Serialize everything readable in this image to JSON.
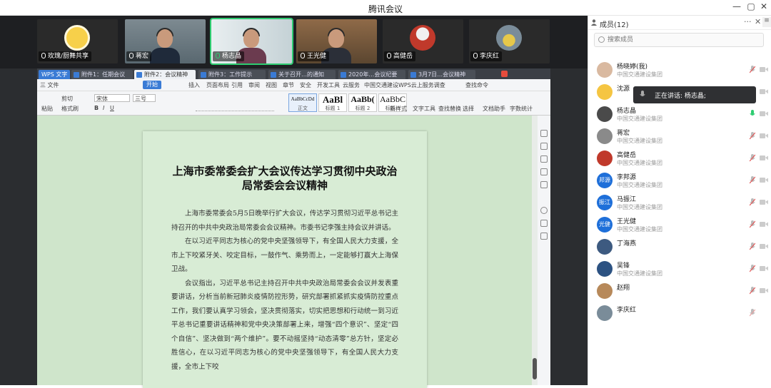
{
  "window": {
    "title": "腾讯会议",
    "controls": [
      "—",
      "▢",
      "✕"
    ]
  },
  "video_tiles": [
    {
      "name": "玫瑰/厨舞共享",
      "muted": true
    },
    {
      "name": "蒋宏",
      "muted": true
    },
    {
      "name": "杨志晶",
      "muted": false,
      "active": true
    },
    {
      "name": "王光健",
      "muted": true
    },
    {
      "name": "高健岳",
      "muted": true
    },
    {
      "name": "李庆红",
      "muted": true
    }
  ],
  "wps": {
    "tabs": [
      "WPS 文字",
      "附件1：任期会议",
      "附件2：会议精神",
      "附件3：工作提示",
      "关于召开…的通知",
      "2020年…会议纪要",
      "3月7日…会议精神"
    ],
    "menu": [
      "三 文件",
      "开始",
      "插入",
      "页面布局",
      "引用",
      "审阅",
      "视图",
      "章节",
      "安全",
      "开发工具",
      "云服务",
      "中国交通建设WPS云上服务调查",
      "查找命令"
    ],
    "toolbar": {
      "paste": "粘贴",
      "cut": "剪切",
      "format_painter": "格式刷",
      "font": "宋体",
      "size": "三号",
      "styles": [
        {
          "sample": "AaBbCcDd",
          "name": "正文"
        },
        {
          "sample": "AaBl",
          "name": "标题 1"
        },
        {
          "sample": "AaBb(",
          "name": "标题 2"
        },
        {
          "sample": "AaBbC",
          "name": "标题 3"
        }
      ],
      "new_style": "新样式",
      "text_tools": "文字工具",
      "find_replace": "查找替换",
      "select": "选择",
      "doc_help": "文档助手",
      "word_count": "字数统计"
    },
    "doc": {
      "title": "上海市委常委会扩大会议传达学习贯彻中央政治局常委会会议精神",
      "paragraphs": [
        "上海市委常委会5月5日晚举行扩大会议，传达学习贯彻习近平总书记主持召开的中共中央政治局常委会会议精神。市委书记李强主持会议并讲话。",
        "在以习近平同志为核心的党中央坚强领导下，有全国人民大力支援，全市上下咬紧牙关、咬定目标，一鼓作气、乘势而上，一定能够打赢大上海保卫战。",
        "会议指出，习近平总书记主持召开中共中央政治局常委会会议并发表重要讲话，分析当前新冠肺炎疫情防控形势，研究部署抓紧抓实疫情防控重点工作，我们要认真学习领会，坚决贯彻落实，切实把思想和行动统一到习近平总书记重要讲话精神和党中央决策部署上来，增强“四个意识”、坚定“四个自信”、坚决做到“两个维护”。要不动摇坚持“动态清零”总方针，坚定必胜信心，在以习近平同志为核心的党中央坚强领导下，有全国人民大力支援，全市上下咬"
      ]
    }
  },
  "members_panel": {
    "title": "成员(12)",
    "search_placeholder": "搜索成员",
    "speaking_label": "正在讲话: 杨志晶;",
    "members": [
      {
        "name": "杨晓婷(我)",
        "org": "中国交通建设集团",
        "avatar_color": "#d9b9a0",
        "avatar_text": "",
        "mic": "muted"
      },
      {
        "name": "沈源",
        "org": "",
        "avatar_color": "#f5c542",
        "avatar_text": "",
        "mic": "muted"
      },
      {
        "name": "杨志晶",
        "org": "中国交通建设集团",
        "avatar_color": "#4a4a4a",
        "avatar_text": "",
        "mic": "on"
      },
      {
        "name": "蒋宏",
        "org": "中国交通建设集团",
        "avatar_color": "#8a8a8a",
        "avatar_text": "",
        "mic": "muted"
      },
      {
        "name": "高健岳",
        "org": "中国交通建设集团",
        "avatar_color": "#c0392b",
        "avatar_text": "",
        "mic": "muted"
      },
      {
        "name": "李邦源",
        "org": "中国交通建设集团",
        "avatar_color": "#1e6fd9",
        "avatar_text": "邦源",
        "mic": "muted"
      },
      {
        "name": "马振江",
        "org": "中国交通建设集团",
        "avatar_color": "#1e6fd9",
        "avatar_text": "振江",
        "mic": "muted"
      },
      {
        "name": "王光健",
        "org": "中国交通建设集团",
        "avatar_color": "#1e6fd9",
        "avatar_text": "光健",
        "mic": "muted"
      },
      {
        "name": "丁海燕",
        "org": "",
        "avatar_color": "#3d5a80",
        "avatar_text": "",
        "mic": "muted"
      },
      {
        "name": "吴锋",
        "org": "中国交通建设集团",
        "avatar_color": "#2c5282",
        "avatar_text": "",
        "mic": "muted"
      },
      {
        "name": "赵翔",
        "org": "",
        "avatar_color": "#b7895a",
        "avatar_text": "",
        "mic": "muted"
      },
      {
        "name": "李庆红",
        "org": "",
        "avatar_color": "#7a8c99",
        "avatar_text": "",
        "mic": "muted_dim"
      }
    ]
  }
}
